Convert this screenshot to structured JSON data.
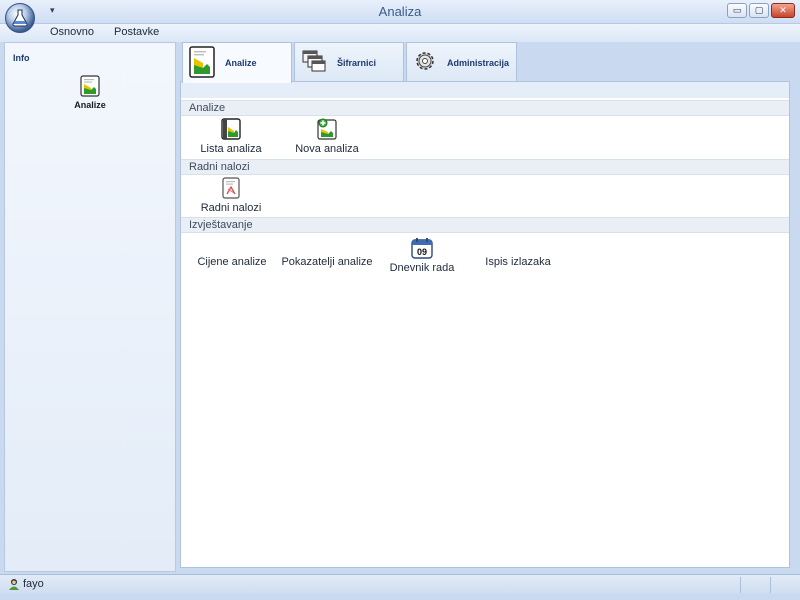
{
  "window": {
    "title": "Analiza",
    "qat_symbol": "▾",
    "buttons": {
      "minimize": "▭",
      "maximize": "▢",
      "close": "✕"
    }
  },
  "menu": {
    "items": [
      "Osnovno",
      "Postavke"
    ]
  },
  "sidebar": {
    "header": "Info",
    "items": [
      {
        "label": "Analize",
        "icon": "document-chart-icon"
      }
    ]
  },
  "tabs": [
    {
      "label": "Analize",
      "icon": "document-chart-icon",
      "active": true
    },
    {
      "label": "Šifrarnici",
      "icon": "windows-stack-icon",
      "active": false
    },
    {
      "label": "Administracija",
      "icon": "gear-icon",
      "active": false
    }
  ],
  "sections": [
    {
      "title": "Analize",
      "items": [
        {
          "label": "Lista analiza",
          "icon": "document-chart-icon"
        },
        {
          "label": "Nova analiza",
          "icon": "document-add-icon"
        }
      ]
    },
    {
      "title": "Radni nalozi",
      "items": [
        {
          "label": "Radni nalozi",
          "icon": "document-red-icon"
        }
      ]
    },
    {
      "title": "Izvještavanje",
      "items": [
        {
          "label": "Cijene analize",
          "icon": ""
        },
        {
          "label": "Pokazatelji analize",
          "icon": ""
        },
        {
          "label": "Dnevnik rada",
          "icon": "calendar-icon",
          "calendar_day": "09"
        },
        {
          "label": "Ispis izlazaka",
          "icon": ""
        }
      ]
    }
  ],
  "statusbar": {
    "user": "fayo",
    "icon": "user-icon"
  }
}
